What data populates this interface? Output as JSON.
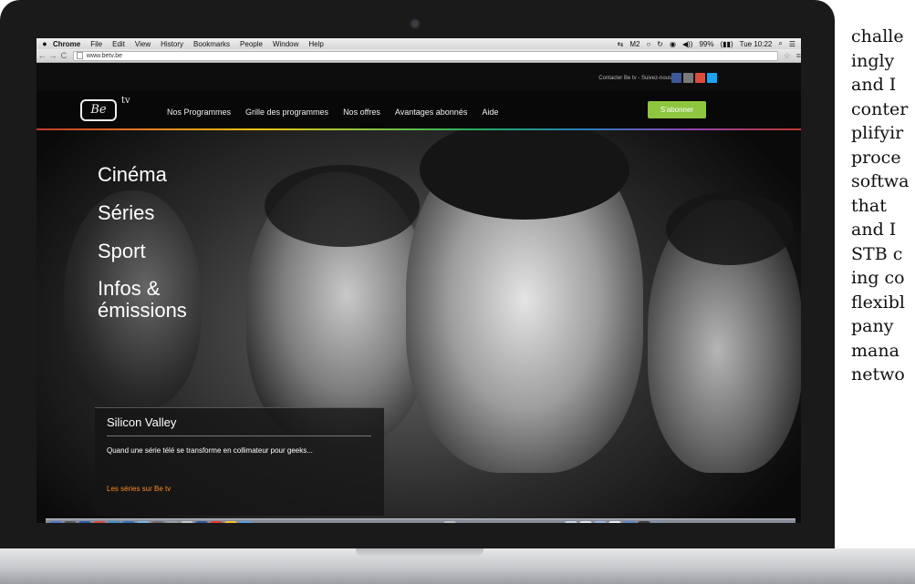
{
  "menubar": {
    "apple": "",
    "items": [
      "Chrome",
      "File",
      "Edit",
      "View",
      "History",
      "Bookmarks",
      "People",
      "Window",
      "Help"
    ],
    "status": [
      "⇆",
      "M2",
      "○",
      "↻",
      "◉",
      "◀))",
      "99%",
      "(▮▮)",
      "Tue 10:22",
      "⌕",
      "☰"
    ]
  },
  "browser": {
    "back": "←",
    "forward": "→",
    "reload": "C",
    "url": "www.betv.be",
    "star": "☆",
    "menu": "≡"
  },
  "site": {
    "contact": "Contacter Be tv - Suivez-nous",
    "social_colors": [
      "#3b5998",
      "#7a7a7a",
      "#dd4b39",
      "#1da1f2"
    ],
    "logo_text": "Be",
    "logo_tv": "tv",
    "nav": [
      "Nos Programmes",
      "Grille des programmes",
      "Nos offres",
      "Avantages abonnés",
      "Aide"
    ],
    "subscribe_label": "S'abonner",
    "categories": [
      "Cinéma",
      "Séries",
      "Sport",
      "Infos & émissions"
    ],
    "show": {
      "title": "Silicon Valley",
      "description": "Quand une série télé se transforme en collimateur pour geeks...",
      "link": "Les séries sur Be tv"
    },
    "accent_green": "#8dc63f",
    "accent_orange": "#ff8a1f"
  },
  "dock": {
    "icon_colors": [
      "#4a78c2",
      "#555555",
      "#2a5aa8",
      "#d94b3a",
      "#3b8fd0",
      "#2f6fbf",
      "#7ab3e0",
      "#6b6b6b",
      "#9a9a9a",
      "#c5c5c5",
      "#2b579a",
      "#e63a2e",
      "#f2c230",
      "#5aa0de"
    ],
    "unknown_glyph": "?"
  },
  "document": {
    "lines": [
      "challe",
      "ingly",
      "and I",
      "conter",
      "plifyir",
      "proce",
      "softwa",
      "that",
      "and I",
      "STB c",
      "ing co",
      "flexibl",
      "pany",
      "mana",
      "netwo"
    ]
  }
}
